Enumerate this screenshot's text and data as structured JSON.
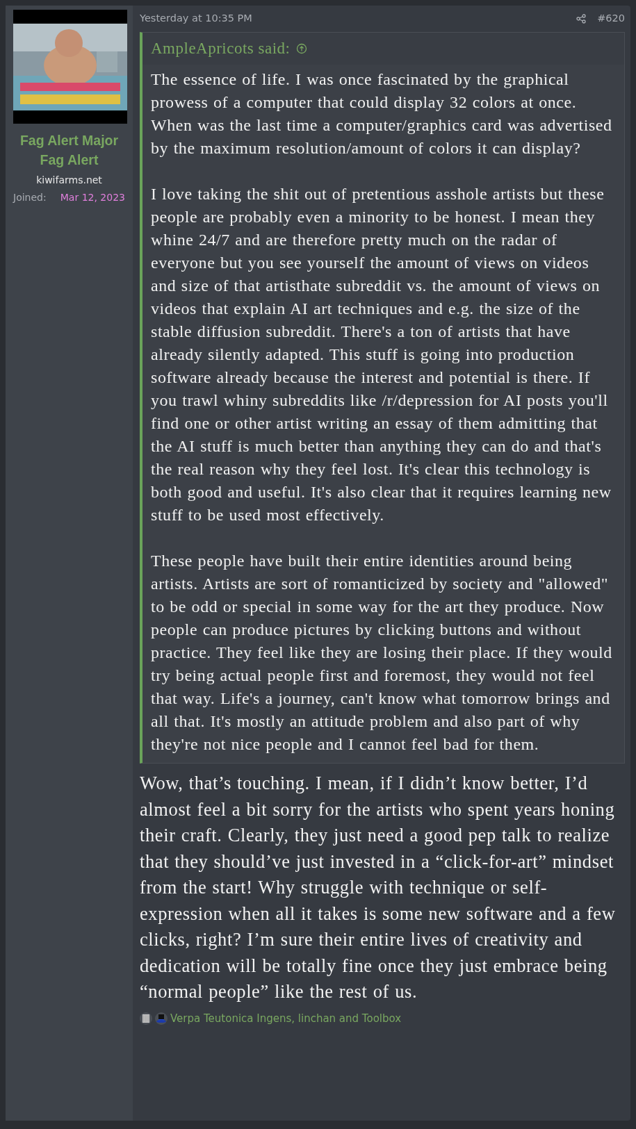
{
  "user": {
    "name": "Fag Alert Major Fag Alert",
    "site": "kiwifarms.net",
    "joined_label": "Joined:",
    "joined_date": "Mar 12, 2023"
  },
  "post": {
    "time": "Yesterday at 10:35 PM",
    "number": "#620",
    "quote": {
      "author": "AmpleApricots said:",
      "paragraphs": [
        "The essence of life. I was once fascinated by the graphical prowess of a computer that could display 32 colors at once. When was the last time a computer/graphics card was advertised by the maximum resolution/amount of colors it can display?",
        "I love taking the shit out of pretentious asshole artists but these people are probably even a minority to be honest. I mean they whine 24/7 and are therefore pretty much on the radar of everyone but you see yourself the amount of views on videos and size of that artisthate subreddit vs. the amount of views on videos that explain AI art techniques and e.g. the size of the stable diffusion subreddit. There's a ton of artists that have already silently adapted. This stuff is going into production software already because the interest and potential is there. If you trawl whiny subreddits like /r/depression for AI posts you'll find one or other artist writing an essay of them admitting that the AI stuff is much better than anything they can do and that's the real reason why they feel lost. It's clear this technology is both good and useful. It's also clear that it requires learning new stuff to be used most effectively.",
        "These people have built their entire identities around being artists. Artists are sort of romanticized by society and \"allowed\" to be odd or special in some way for the art they produce. Now people can produce pictures by clicking buttons and without practice. They feel like they are losing their place. If they would try being actual people first and foremost, they would not feel that way. Life's a journey, can't know what tomorrow brings and all that. It's mostly an attitude problem and also part of why they're not nice people and I cannot feel bad for them."
      ]
    },
    "body": "Wow, that’s touching. I mean, if I didn’t know better, I’d almost feel a bit sorry for the artists who spent years honing their craft. Clearly, they just need a good pep talk to realize that they should’ve just invested in a “click-for-art” mindset from the start! Why struggle with technique or self-expression when all it takes is some new software and a few clicks, right? I’m sure their entire lives of creativity and dedication will be totally fine once they just embrace being “normal people” like the rest of us.",
    "reactions": {
      "icons": [
        {
          "kind": "archive"
        },
        {
          "kind": "tophat"
        }
      ],
      "text": "Verpa Teutonica Ingens, linchan and Toolbox"
    }
  }
}
